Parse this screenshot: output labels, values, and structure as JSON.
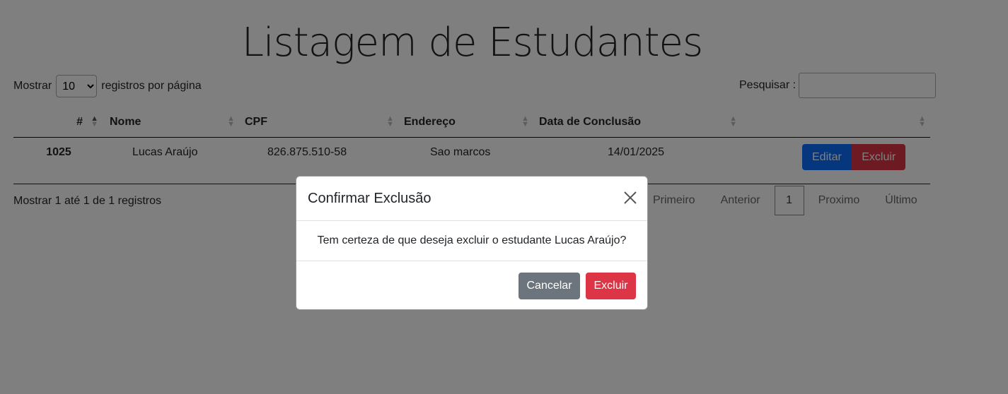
{
  "page": {
    "title": "Listagem de Estudantes",
    "length_label_before": "Mostrar",
    "length_value": "10",
    "length_label_after": "registros por página",
    "search_label": "Pesquisar :",
    "search_value": ""
  },
  "table": {
    "columns": [
      "#",
      "Nome",
      "CPF",
      "Endereço",
      "Data de Conclusão",
      ""
    ],
    "rows": [
      {
        "id": "1025",
        "nome": "Lucas Araújo",
        "cpf": "826.875.510-58",
        "endereco": "Sao marcos",
        "data": "14/01/2025",
        "edit_label": "Editar",
        "delete_label": "Excluir"
      }
    ]
  },
  "footer": {
    "info": "Mostrar 1 até 1 de 1 registros",
    "first": "Primeiro",
    "prev": "Anterior",
    "current_page": "1",
    "next": "Proximo",
    "last": "Último"
  },
  "modal": {
    "title": "Confirmar Exclusão",
    "message": "Tem certeza de que deseja excluir o estudante Lucas Araújo?",
    "cancel_label": "Cancelar",
    "confirm_label": "Excluir",
    "close_icon": "close-icon"
  },
  "colors": {
    "primary": "#0d6efd",
    "danger": "#dc3545",
    "secondary": "#6c757d",
    "backdrop": "rgba(0,0,0,0.5)"
  }
}
